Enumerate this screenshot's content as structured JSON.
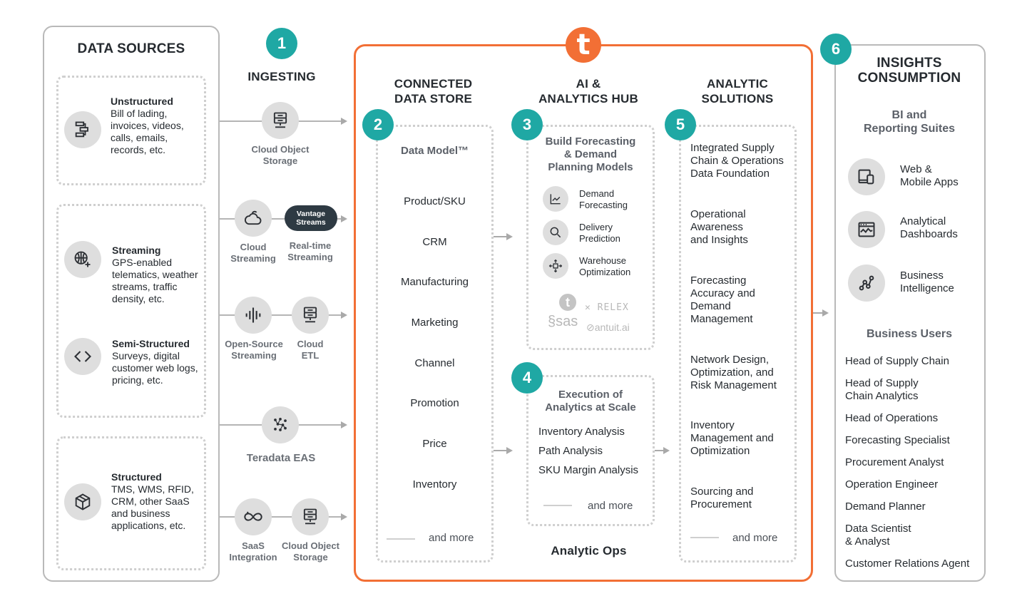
{
  "colors": {
    "teal": "#1fa8a4",
    "orange": "#f26f35",
    "dark": "#262b30",
    "grey_text": "#5b6068"
  },
  "data_sources": {
    "title": "DATA SOURCES",
    "groups": [
      {
        "label": "Unstructured",
        "desc_lines": [
          "Bill of lading,",
          "invoices, videos,",
          "calls, emails,",
          "records, etc."
        ],
        "icon": "hierarchy-icon"
      },
      {
        "label": "Streaming",
        "desc_lines": [
          "GPS-enabled",
          "telematics, weather",
          "streams, traffic",
          "density, etc."
        ],
        "icon": "globe-plus-icon"
      },
      {
        "label": "Semi-Structured",
        "desc_lines": [
          "Surveys, digital",
          "customer web logs,",
          "pricing, etc."
        ],
        "icon": "code-brackets-icon"
      },
      {
        "label": "Structured",
        "desc_lines": [
          "TMS, WMS, RFID,",
          "CRM, other SaaS",
          "and business",
          "applications, etc."
        ],
        "icon": "package-box-icon"
      }
    ]
  },
  "ingesting": {
    "step": "1",
    "title": "INGESTING",
    "nodes": {
      "cloud_object_storage_top": "Cloud Object\nStorage",
      "cloud_streaming": "Cloud\nStreaming",
      "vantage_streams": "Vantage\nStreams",
      "realtime_streaming": "Real-time\nStreaming",
      "open_source_streaming": "Open-Source\nStreaming",
      "cloud_etl": "Cloud\nETL",
      "teradata_eas": "Teradata EAS",
      "saas_integration": "SaaS\nIntegration",
      "cloud_object_storage_bottom": "Cloud Object\nStorage"
    }
  },
  "platform": {
    "logo_letter": "t",
    "connected_store": {
      "step": "2",
      "title": "CONNECTED\nDATA STORE",
      "subtitle": "Data Model™",
      "items": [
        "Product/SKU",
        "CRM",
        "Manufacturing",
        "Marketing",
        "Channel",
        "Promotion",
        "Price",
        "Inventory"
      ],
      "more": "and more"
    },
    "ai_hub": {
      "title": "AI &\nANALYTICS HUB",
      "build": {
        "step": "3",
        "title": "Build Forecasting\n& Demand\nPlanning Models",
        "models": [
          {
            "label": "Demand\nForecasting",
            "icon": "line-chart-icon"
          },
          {
            "label": "Delivery\nPrediction",
            "icon": "magnifier-icon"
          },
          {
            "label": "Warehouse\nOptimization",
            "icon": "box-arrows-icon"
          }
        ],
        "vendors": [
          "t",
          "RELEX",
          "sas",
          "antuit.ai"
        ]
      },
      "execution": {
        "step": "4",
        "title": "Execution of\nAnalytics at Scale",
        "items": [
          "Inventory Analysis",
          "Path Analysis",
          "SKU Margin Analysis"
        ],
        "more": "and more"
      },
      "footer": "Analytic Ops"
    },
    "solutions": {
      "step": "5",
      "title": "ANALYTIC\nSOLUTIONS",
      "items": [
        "Integrated Supply\nChain & Operations\nData Foundation",
        "Operational\nAwareness\nand Insights",
        "Forecasting\nAccuracy and\nDemand\nManagement",
        "Network Design,\nOptimization, and\nRisk Management",
        "Inventory\nManagement and\nOptimization",
        "Sourcing and\nProcurement"
      ],
      "more": "and more"
    }
  },
  "insights": {
    "step": "6",
    "title": "INSIGHTS\nCONSUMPTION",
    "bi_title": "BI and\nReporting Suites",
    "bi_items": [
      {
        "label": "Web &\nMobile Apps",
        "icon": "devices-icon"
      },
      {
        "label": "Analytical\nDashboards",
        "icon": "dashboard-icon"
      },
      {
        "label": "Business\nIntelligence",
        "icon": "network-nodes-icon"
      }
    ],
    "users_title": "Business Users",
    "users": [
      "Head of Supply Chain",
      "Head of Supply\nChain Analytics",
      "Head of Operations",
      "Forecasting Specialist",
      "Procurement Analyst",
      "Operation Engineer",
      "Demand Planner",
      "Data Scientist\n& Analyst",
      "Customer Relations Agent"
    ]
  }
}
